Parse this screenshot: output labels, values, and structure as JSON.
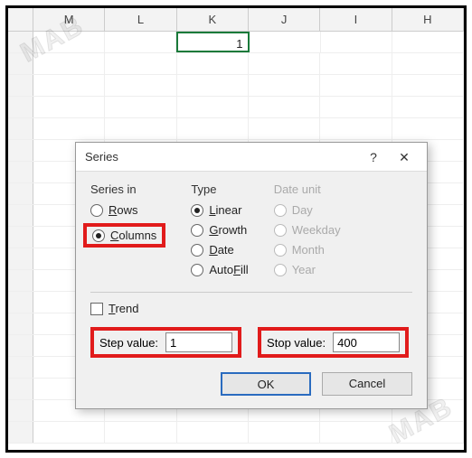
{
  "sheet": {
    "columns": [
      "M",
      "L",
      "K",
      "J",
      "I",
      "H"
    ],
    "selected_cell_value": "1",
    "selected_column": "K"
  },
  "dialog": {
    "title": "Series",
    "series_in_label": "Series in",
    "rows_label": "Rows",
    "columns_label": "Columns",
    "type_label": "Type",
    "linear_label": "Linear",
    "growth_label": "Growth",
    "date_label": "Date",
    "autofill_label": "AutoFill",
    "date_unit_label": "Date unit",
    "day_label": "Day",
    "weekday_label": "Weekday",
    "month_label": "Month",
    "year_label": "Year",
    "trend_label": "Trend",
    "step_label": "Step value:",
    "step_value": "1",
    "stop_label": "Stop value:",
    "stop_value": "400",
    "ok": "OK",
    "cancel": "Cancel",
    "help": "?",
    "close": "✕"
  },
  "watermark": "MAB"
}
